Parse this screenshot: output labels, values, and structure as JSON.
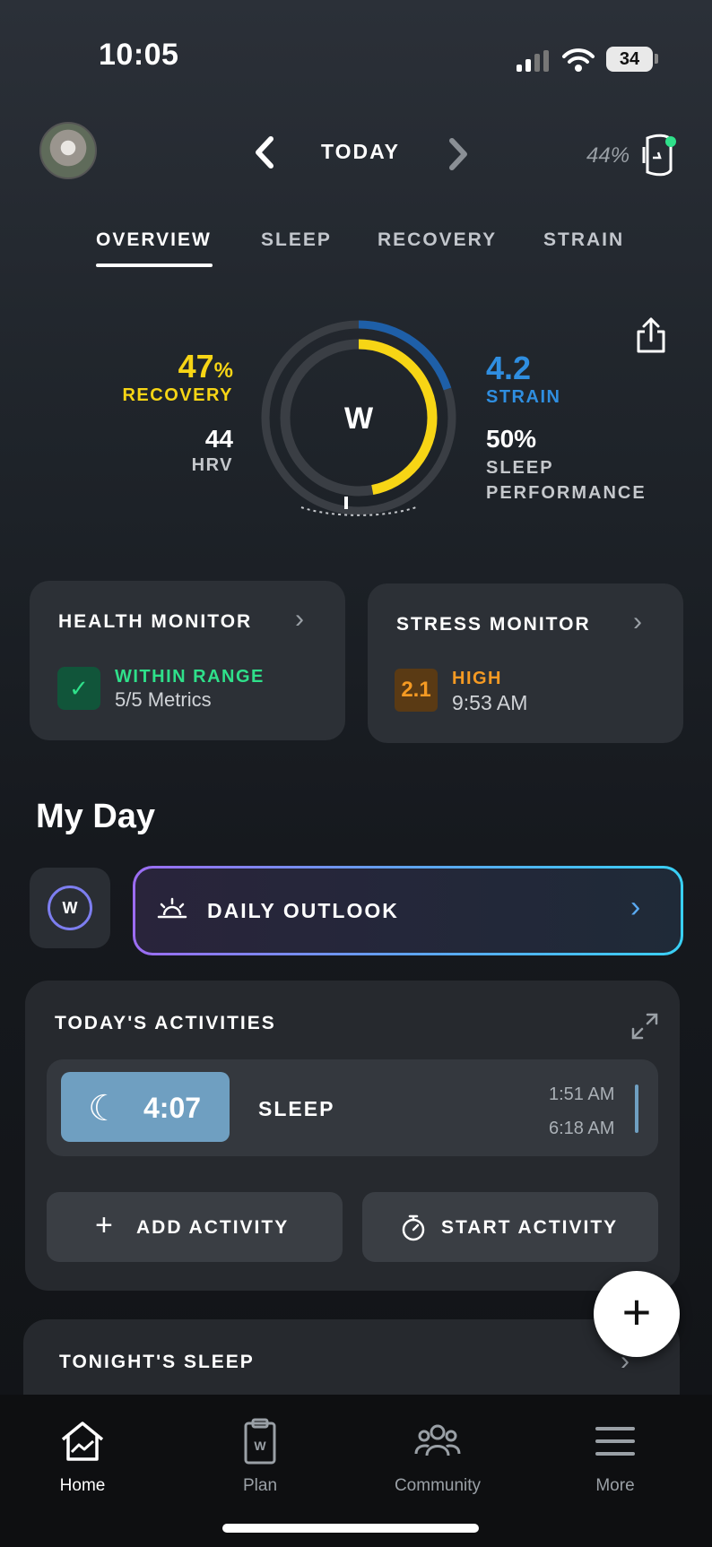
{
  "status_bar": {
    "time": "10:05",
    "battery": "34"
  },
  "header": {
    "date_label": "TODAY",
    "device_battery": "44%",
    "prev_icon": "chevron-left-icon",
    "next_icon": "chevron-right-icon"
  },
  "tabs": [
    {
      "label": "OVERVIEW",
      "active": true
    },
    {
      "label": "SLEEP",
      "active": false
    },
    {
      "label": "RECOVERY",
      "active": false
    },
    {
      "label": "STRAIN",
      "active": false
    }
  ],
  "overview": {
    "recovery_value": "47",
    "recovery_unit": "%",
    "recovery_label": "RECOVERY",
    "hrv_value": "44",
    "hrv_label": "HRV",
    "strain_value": "4.2",
    "strain_label": "STRAIN",
    "sleep_value": "50%",
    "sleep_label_line1": "SLEEP",
    "sleep_label_line2": "PERFORMANCE",
    "gauge_center": "W",
    "recovery_fraction": 0.47,
    "strain_fraction": 0.2,
    "sleep_fraction": 0.5,
    "colors": {
      "recovery": "#f7d515",
      "strain": "#2f8ee0"
    }
  },
  "health_monitor": {
    "title": "HEALTH MONITOR",
    "status": "WITHIN RANGE",
    "detail": "5/5 Metrics",
    "status_color": "#2fe08a"
  },
  "stress_monitor": {
    "title": "STRESS MONITOR",
    "score": "2.1",
    "level": "HIGH",
    "time": "9:53 AM",
    "level_color": "#f59a23"
  },
  "my_day": {
    "title": "My Day",
    "outlook_label": "DAILY OUTLOOK"
  },
  "activities": {
    "title": "TODAY'S ACTIVITIES",
    "items": [
      {
        "duration": "4:07",
        "name": "SLEEP",
        "start": "1:51 AM",
        "end": "6:18 AM"
      }
    ],
    "add_label": "ADD ACTIVITY",
    "start_label": "START ACTIVITY"
  },
  "tonight": {
    "title": "TONIGHT'S SLEEP"
  },
  "tabbar": [
    {
      "label": "Home",
      "icon": "home-icon",
      "active": true
    },
    {
      "label": "Plan",
      "icon": "clipboard-icon",
      "active": false
    },
    {
      "label": "Community",
      "icon": "community-icon",
      "active": false
    },
    {
      "label": "More",
      "icon": "menu-icon",
      "active": false
    }
  ]
}
